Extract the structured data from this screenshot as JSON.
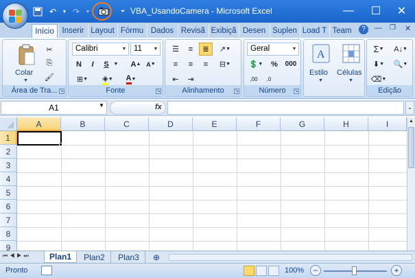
{
  "window": {
    "title": "VBA_UsandoCamera - Microsoft Excel"
  },
  "tabs": [
    "Início",
    "Inserir",
    "Layout",
    "Fórmu",
    "Dados",
    "Revisã",
    "Exibiçã",
    "Desen",
    "Suplen",
    "Load T",
    "Team"
  ],
  "ribbon": {
    "clipboard": {
      "paste_label": "Colar",
      "group_label": "Área de Tra..."
    },
    "font": {
      "name": "Calibri",
      "size": "11",
      "group_label": "Fonte",
      "bold": "N",
      "italic": "I",
      "underline": "S"
    },
    "alignment": {
      "group_label": "Alinhamento"
    },
    "number": {
      "format": "Geral",
      "group_label": "Número",
      "percent": "%",
      "thousands": "000"
    },
    "styles": {
      "label": "Estilo"
    },
    "cells": {
      "label": "Células"
    },
    "editing": {
      "group_label": "Edição"
    }
  },
  "formula_bar": {
    "name_box": "A1",
    "fx": "fx",
    "value": ""
  },
  "columns": [
    "A",
    "B",
    "C",
    "D",
    "E",
    "F",
    "G",
    "H",
    "I"
  ],
  "rows": [
    "1",
    "2",
    "3",
    "4",
    "5",
    "6",
    "7",
    "8",
    "9"
  ],
  "sheets": [
    "Plan1",
    "Plan2",
    "Plan3"
  ],
  "status": {
    "ready": "Pronto",
    "zoom": "100%"
  },
  "colors": {
    "accent": "#1f65c8",
    "highlight": "#f07a1a"
  }
}
